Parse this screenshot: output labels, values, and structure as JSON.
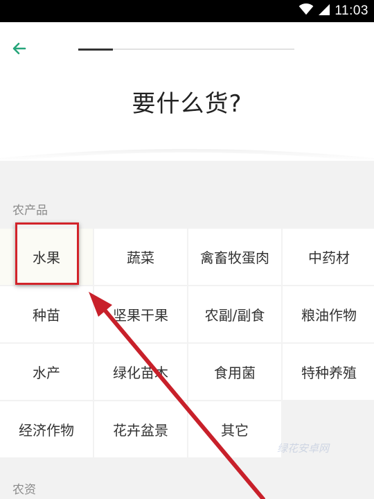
{
  "status_bar": {
    "time": "11:03",
    "icons": [
      "wifi-icon",
      "signal-icon"
    ]
  },
  "header": {
    "back_icon": "arrow-left-icon",
    "progress": 0.16,
    "title": "要什么货?"
  },
  "sections": [
    {
      "label": "农产品",
      "items": [
        "水果",
        "蔬菜",
        "禽畜牧蛋肉",
        "中药材",
        "种苗",
        "坚果干果",
        "农副/副食",
        "粮油作物",
        "水产",
        "绿化苗木",
        "食用菌",
        "特种养殖",
        "经济作物",
        "花卉盆景",
        "其它"
      ]
    },
    {
      "label": "农资"
    }
  ],
  "annotation": {
    "highlight_color": "#d2232a",
    "selected_item": "水果"
  },
  "watermark": "绿花安卓网",
  "colors": {
    "accent": "#26a57a",
    "status_bar": "#000000",
    "background": "#f2f2f2"
  }
}
